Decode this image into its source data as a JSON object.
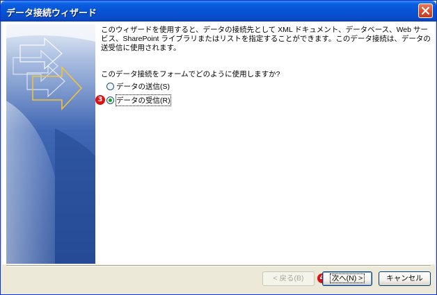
{
  "window": {
    "title": "データ接続ウィザード"
  },
  "intro_text": "このウィザードを使用すると、データの接続先として XML ドキュメント、データベース、Web サービス、SharePoint ライブラリまたはリストを指定することができます。このデータ接続は、データの送受信に使用されます。",
  "question": "このデータ接続をフォームでどのように使用しますか?",
  "options": [
    {
      "label": "データの送信(S)",
      "selected": false
    },
    {
      "label": "データの受信(R)",
      "selected": true
    }
  ],
  "markers": {
    "option_marker": "3",
    "next_marker": "4"
  },
  "buttons": {
    "back": "< 戻る(B)",
    "next": "次へ(N) >",
    "cancel": "キャンセル"
  },
  "colors": {
    "titlebar": "#0754d5",
    "dialog_bg": "#ece9d8",
    "marker": "#e01010",
    "side_panel": "#2f5aa8"
  },
  "icons": {
    "close": "close-icon",
    "side_art": "wizard-arrow-banner"
  }
}
